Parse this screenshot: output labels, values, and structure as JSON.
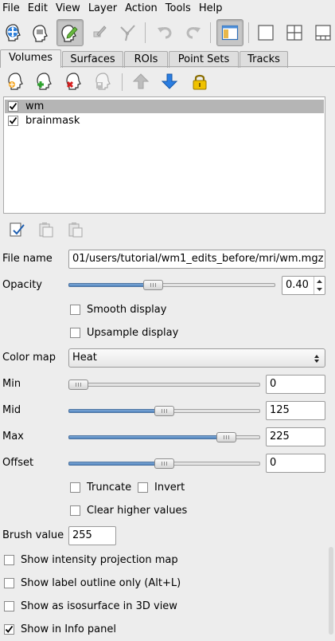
{
  "menubar": [
    "File",
    "Edit",
    "View",
    "Layer",
    "Action",
    "Tools",
    "Help"
  ],
  "toolbar": {
    "buttons": [
      "navigate-icon",
      "voxel-edit-icon",
      "recon-edit-icon",
      "roi-edit-icon",
      "point-set-edit-icon",
      "undo-icon",
      "redo-icon",
      "toggle-panel-icon",
      "layout-1x1-icon",
      "layout-2x2-icon",
      "layout-1-3-icon"
    ],
    "active": [
      "recon-edit-icon",
      "toggle-panel-icon"
    ]
  },
  "tabs": [
    "Volumes",
    "Surfaces",
    "ROIs",
    "Point Sets",
    "Tracks"
  ],
  "active_tab": "Volumes",
  "layer_toolbar": [
    "load-volume-icon",
    "new-volume-icon",
    "close-volume-icon",
    "save-volume-icon",
    "move-up-icon",
    "move-down-icon",
    "lock-icon"
  ],
  "layers": [
    {
      "name": "wm",
      "checked": true,
      "selected": true
    },
    {
      "name": "brainmask",
      "checked": true,
      "selected": false
    }
  ],
  "bottom_toolbar": [
    "select-all-icon",
    "copy-icon",
    "paste-icon"
  ],
  "properties": {
    "file_name_label": "File name",
    "file_name": "01/users/tutorial/wm1_edits_before/mri/wm.mgz",
    "opacity_label": "Opacity",
    "opacity": "0.40",
    "opacity_fraction": 0.4,
    "smooth_display": "Smooth display",
    "upsample_display": "Upsample display",
    "color_map_label": "Color map",
    "color_map": "Heat",
    "min_label": "Min",
    "min": "0",
    "mid_label": "Mid",
    "mid": "125",
    "max_label": "Max",
    "max": "225",
    "offset_label": "Offset",
    "offset": "0",
    "truncate": "Truncate",
    "invert": "Invert",
    "clear_higher": "Clear higher values",
    "brush_value_label": "Brush value",
    "brush_value": "255",
    "show_intensity_projection": "Show intensity projection map",
    "show_label_outline": "Show label outline only (Alt+L)",
    "show_isosurface": "Show as isosurface in 3D view",
    "show_info_panel": "Show in Info panel",
    "show_info_panel_checked": true
  },
  "sliders": {
    "opacity": 0.4,
    "min": 0.0,
    "mid": 0.5,
    "max": 0.86,
    "offset": 0.5
  },
  "colors": {
    "background": "#ededed",
    "selection": "#b5b5b5",
    "slider_fill": "#4f83bd",
    "arrow_blue": "#2a7de1",
    "lock_gold": "#e6b800"
  }
}
